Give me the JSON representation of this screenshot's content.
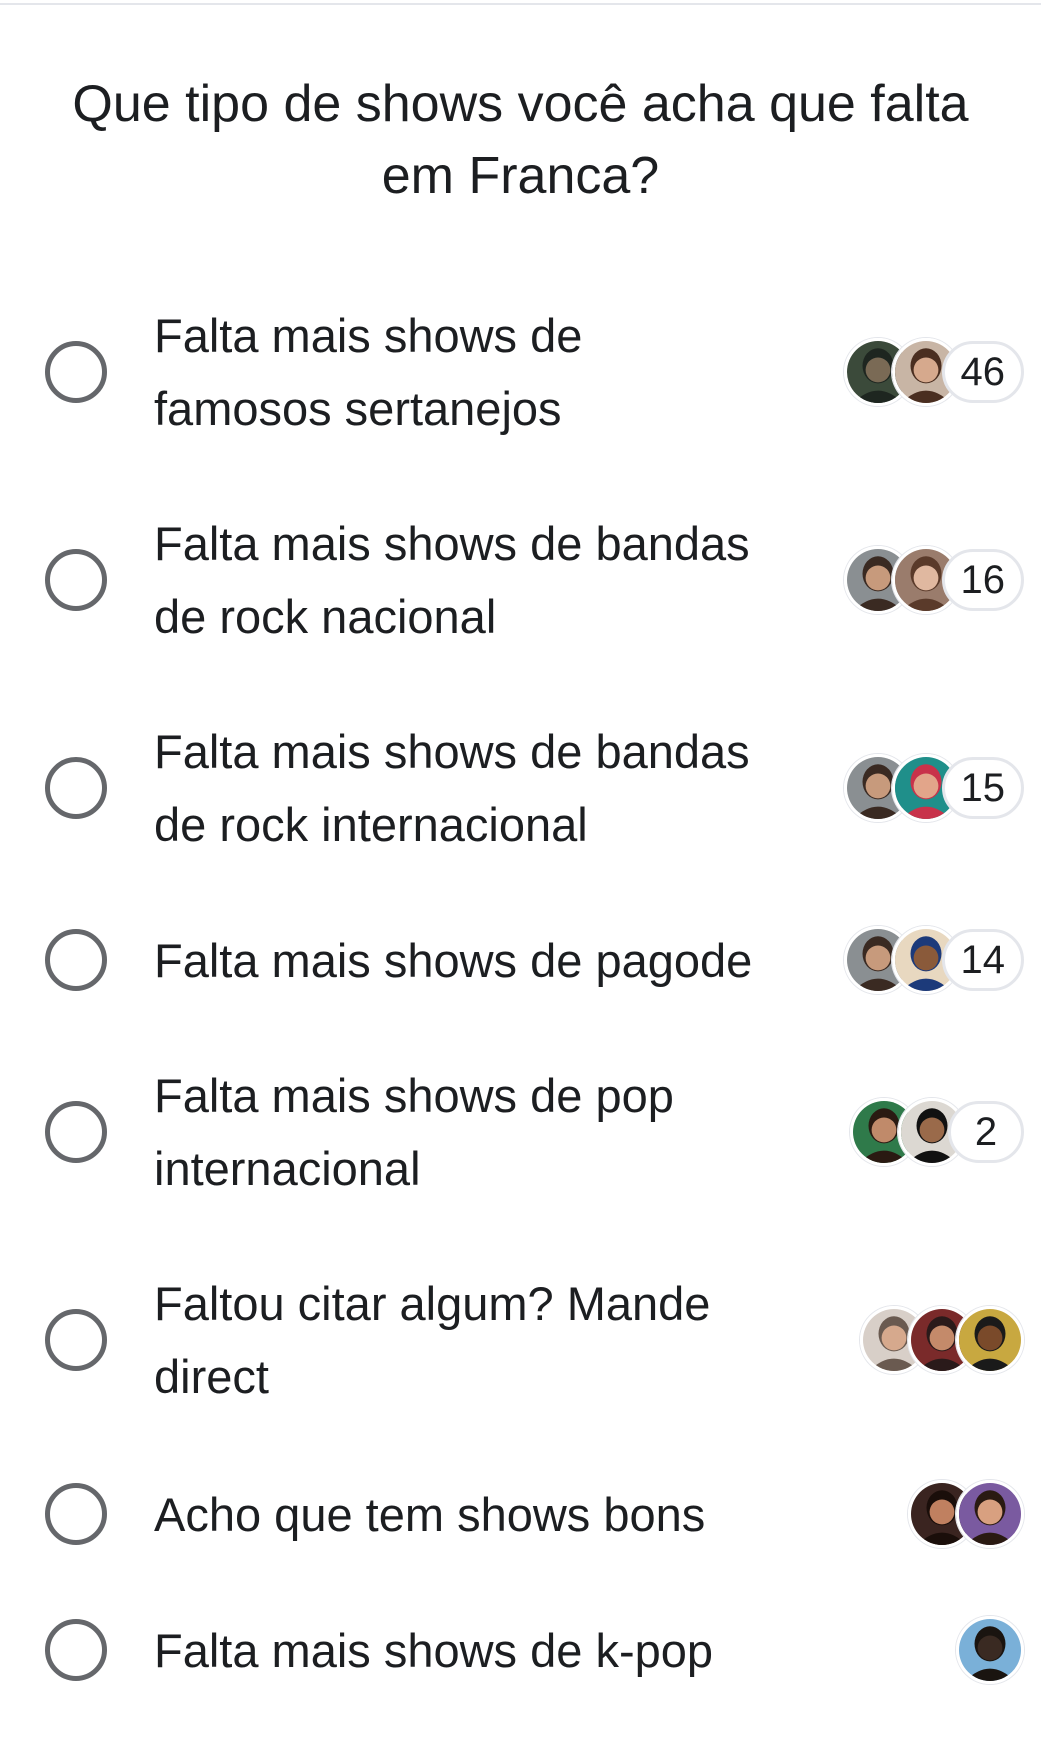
{
  "poll": {
    "question": "Que tipo de shows você acha que falta em Franca?",
    "options": [
      {
        "line1": "Falta mais shows de",
        "line2": "famosos sertanejos",
        "count": "46",
        "avatars": [
          {
            "bg": "#3b4a3a",
            "skin": "#7a6a55",
            "hair": "#1e2620"
          },
          {
            "bg": "#c8b5a5",
            "skin": "#d6a98d",
            "hair": "#4a2e20"
          }
        ]
      },
      {
        "line1": "Falta mais shows de bandas",
        "line2": "de rock nacional",
        "count": "16",
        "avatars": [
          {
            "bg": "#8a8f92",
            "skin": "#c79a7c",
            "hair": "#3a2a22"
          },
          {
            "bg": "#9a7c6c",
            "skin": "#e0b8a0",
            "hair": "#5a3a2a"
          }
        ]
      },
      {
        "line1": "Falta mais shows de bandas",
        "line2": "de rock internacional",
        "count": "15",
        "avatars": [
          {
            "bg": "#8a8f92",
            "skin": "#c79a7c",
            "hair": "#3a2a22"
          },
          {
            "bg": "#1f8f8a",
            "skin": "#e2a58a",
            "hair": "#c8324a"
          }
        ]
      },
      {
        "line1": "Falta mais shows de pagode",
        "line2": "",
        "count": "14",
        "avatars": [
          {
            "bg": "#8a8f92",
            "skin": "#c79a7c",
            "hair": "#3a2a22"
          },
          {
            "bg": "#e8d8c0",
            "skin": "#8a5a3a",
            "hair": "#1c3a7a"
          }
        ]
      },
      {
        "line1": "Falta mais shows de pop",
        "line2": "internacional",
        "count": "2",
        "avatars": [
          {
            "bg": "#2f7a4a",
            "skin": "#c08a6a",
            "hair": "#2a1a12"
          },
          {
            "bg": "#dcd8d2",
            "skin": "#9a6a4a",
            "hair": "#111111"
          }
        ]
      },
      {
        "line1": "Faltou citar algum? Mande",
        "line2": "direct",
        "count": "",
        "avatars": [
          {
            "bg": "#d8cfc8",
            "skin": "#d6a98d",
            "hair": "#6a5a50"
          },
          {
            "bg": "#7a2a2a",
            "skin": "#c48a6a",
            "hair": "#2a1a1a"
          },
          {
            "bg": "#c8a840",
            "skin": "#7a4a2a",
            "hair": "#1a1a1a"
          }
        ]
      },
      {
        "line1": "Acho que tem shows bons",
        "line2": "",
        "count": "",
        "avatars": [
          {
            "bg": "#3a2420",
            "skin": "#c08060",
            "hair": "#1a0e0a"
          },
          {
            "bg": "#7a5aa0",
            "skin": "#d8a080",
            "hair": "#2a1a12"
          }
        ]
      },
      {
        "line1": "Falta mais shows de k-pop",
        "line2": "",
        "count": "",
        "avatars": [
          {
            "bg": "#7ab0d8",
            "skin": "#3a2a22",
            "hair": "#1a1410"
          }
        ]
      }
    ]
  }
}
